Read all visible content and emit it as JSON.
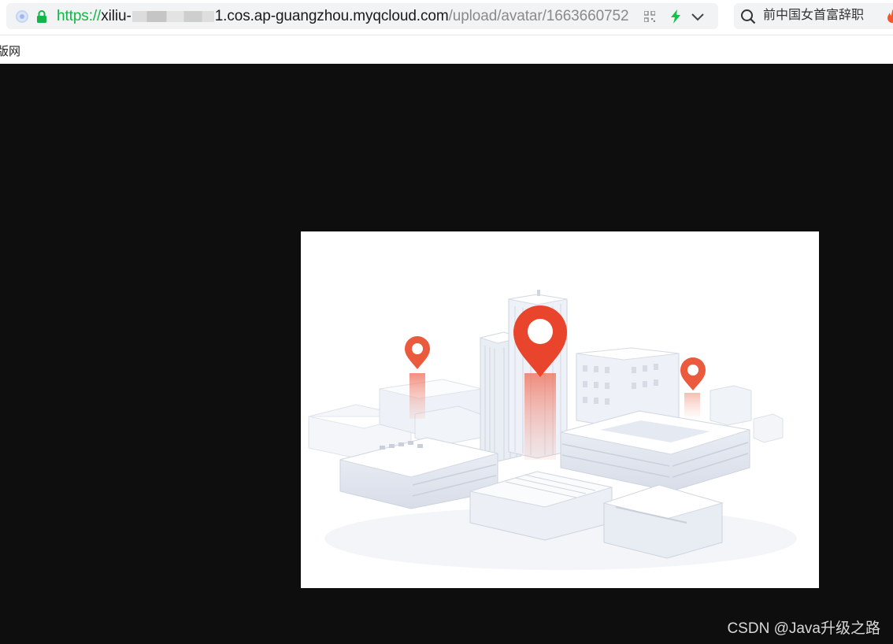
{
  "browser": {
    "url": {
      "scheme": "https://",
      "host_start": "xiliu-",
      "host_end": "1.cos.ap-guangzhou.myqcloud.com",
      "path": "/upload/avatar/1663660752"
    },
    "search": {
      "text": "前中国女首富辞职"
    },
    "bookmark": {
      "label": "版网"
    }
  },
  "watermark": {
    "text": "CSDN @Java升级之路"
  },
  "colors": {
    "url_scheme": "#12b548",
    "page_background": "#0e0e0e",
    "pin_red": "#e8452c",
    "bolt_green": "#12c24a"
  },
  "icons": [
    "site-icon",
    "lock-icon",
    "qr-code-icon",
    "lightning-icon",
    "chevron-down-icon",
    "search-icon",
    "fire-icon"
  ]
}
